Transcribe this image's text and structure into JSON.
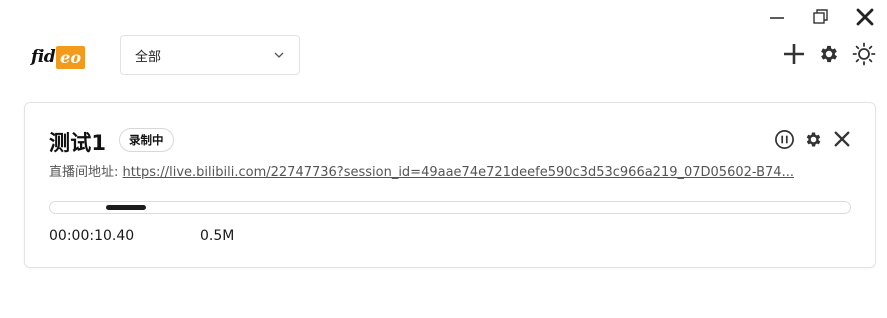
{
  "window": {
    "controls": [
      "minimize",
      "restore",
      "close"
    ]
  },
  "header": {
    "logo_part1": "fid",
    "logo_part2": "eo",
    "filter": {
      "selected": "全部"
    },
    "toolbar": [
      "add-icon",
      "settings-icon",
      "theme-icon"
    ]
  },
  "task": {
    "title": "测试1",
    "status_badge": "录制中",
    "addr_label": "直播间地址:",
    "addr_url": "https://live.bilibili.com/22747736?session_id=49aae74e721deefe590c3d53c966a219_07D05602-B74...",
    "progress_indeterminate": true,
    "progress_indicator_position": 0.07,
    "elapsed": "00:00:10.40",
    "size": "0.5M",
    "actions": [
      "pause-icon",
      "settings-icon",
      "close-icon"
    ]
  },
  "colors": {
    "brand": "#f29a1b",
    "text": "#1f1f1f",
    "border": "#e3e3e3"
  }
}
